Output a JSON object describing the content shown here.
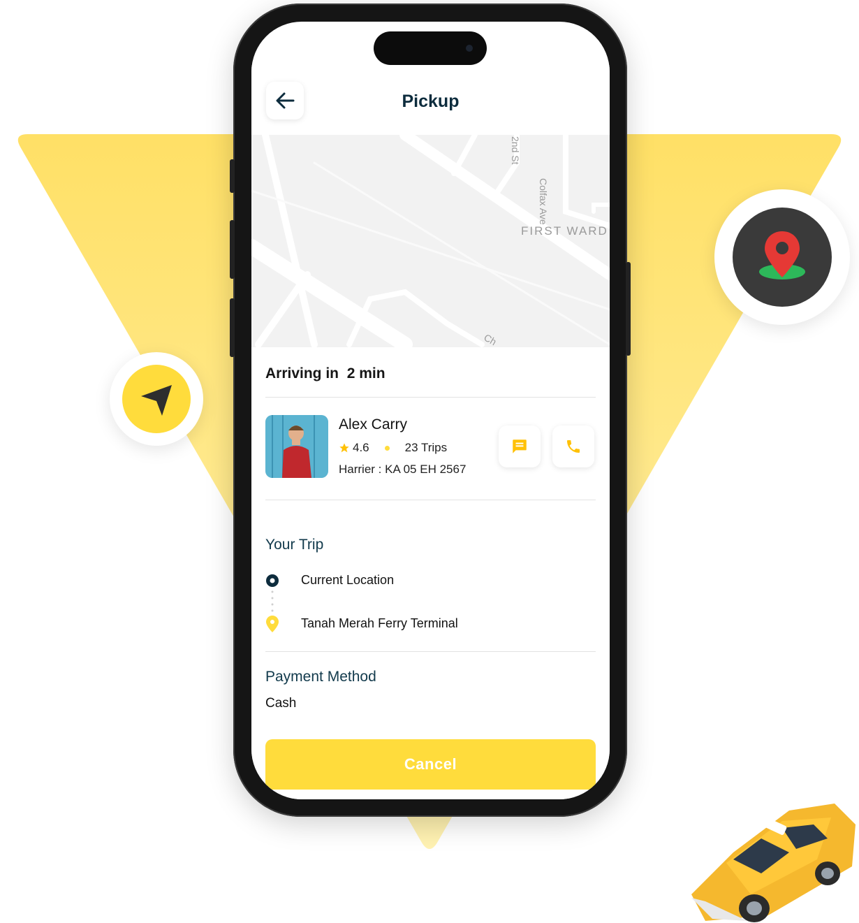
{
  "colors": {
    "accent": "#FFDC3C",
    "navy": "#0d2c3d",
    "pin_red": "#E53935",
    "pin_green": "#2DB85A"
  },
  "header": {
    "title": "Pickup",
    "back_icon": "arrow-left-icon"
  },
  "map": {
    "labels": [
      "FIRST WARD",
      "Colfax Ave",
      "2nd St",
      "Ch"
    ]
  },
  "status": {
    "arriving_label": "Arriving in",
    "eta": "2 min"
  },
  "driver": {
    "name": "Alex Carry",
    "rating": "4.6",
    "trips": "23 Trips",
    "vehicle_label": "Harrier :",
    "plate": "KA 05 EH 2567"
  },
  "trip": {
    "title": "Your Trip",
    "origin": "Current Location",
    "destination": "Tanah Merah Ferry Terminal"
  },
  "payment": {
    "title": "Payment Method",
    "method": "Cash"
  },
  "actions": {
    "cancel_label": "Cancel",
    "message_icon": "chat-icon",
    "call_icon": "phone-icon"
  }
}
